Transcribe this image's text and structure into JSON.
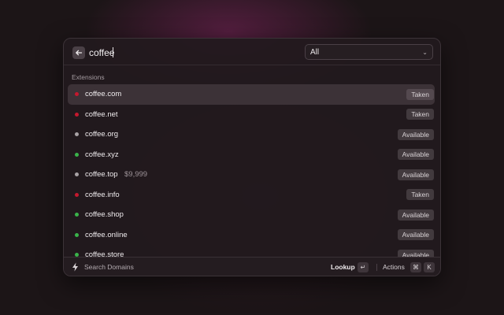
{
  "search": {
    "value": "coffee"
  },
  "filter": {
    "selected": "All"
  },
  "section": {
    "label": "Extensions"
  },
  "status_colors": {
    "taken": "#c4182e",
    "available": "#3ab34a",
    "premium": "#a8a2a5"
  },
  "results": [
    {
      "domain": "coffee.com",
      "price": "",
      "status": "Taken",
      "dot": "taken"
    },
    {
      "domain": "coffee.net",
      "price": "",
      "status": "Taken",
      "dot": "taken"
    },
    {
      "domain": "coffee.org",
      "price": "",
      "status": "Available",
      "dot": "premium"
    },
    {
      "domain": "coffee.xyz",
      "price": "",
      "status": "Available",
      "dot": "available"
    },
    {
      "domain": "coffee.top",
      "price": "$9,999",
      "status": "Available",
      "dot": "premium"
    },
    {
      "domain": "coffee.info",
      "price": "",
      "status": "Taken",
      "dot": "taken"
    },
    {
      "domain": "coffee.shop",
      "price": "",
      "status": "Available",
      "dot": "available"
    },
    {
      "domain": "coffee.online",
      "price": "",
      "status": "Available",
      "dot": "available"
    },
    {
      "domain": "coffee.store",
      "price": "",
      "status": "Available",
      "dot": "available"
    }
  ],
  "footer": {
    "extension_title": "Search Domains",
    "primary_action": "Lookup",
    "primary_key": "↵",
    "actions_label": "Actions",
    "actions_keys": [
      "⌘",
      "K"
    ]
  }
}
